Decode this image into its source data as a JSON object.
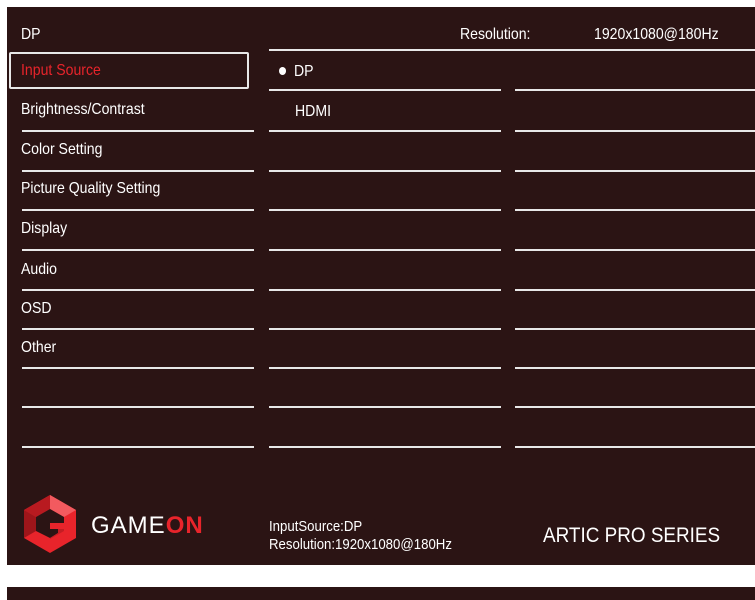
{
  "header": {
    "current_input": "DP",
    "resolution_label": "Resolution:",
    "resolution_value": "1920x1080@180Hz"
  },
  "menu": {
    "items": [
      {
        "label": "Input Source"
      },
      {
        "label": "Brightness/Contrast"
      },
      {
        "label": "Color Setting"
      },
      {
        "label": "Picture Quality Setting"
      },
      {
        "label": "Display"
      },
      {
        "label": "Audio"
      },
      {
        "label": "OSD"
      },
      {
        "label": "Other"
      }
    ],
    "selected": "Input Source"
  },
  "submenu": {
    "options": [
      {
        "label": "DP",
        "selected": true
      },
      {
        "label": "HDMI",
        "selected": false
      }
    ]
  },
  "footer": {
    "brand_part1": "GAME",
    "brand_part2": "ON",
    "input_info": "InputSource:DP",
    "resolution_info": "Resolution:1920x1080@180Hz",
    "series": "ARTIC PRO SERIES"
  },
  "colors": {
    "background": "#2b1414",
    "accent": "#e8242b",
    "text": "#ffffff"
  },
  "icons": {
    "logo": "gameon-logo-icon",
    "selected_marker": "radio-dot-icon"
  }
}
